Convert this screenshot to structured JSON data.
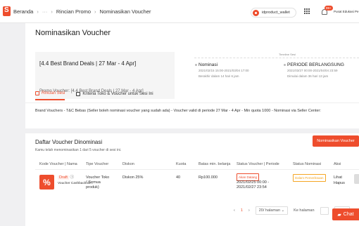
{
  "breadcrumb": {
    "home": "Beranda",
    "ellipsis": "···",
    "parent": "Rincian Promo",
    "current": "Nominasikan Voucher"
  },
  "header": {
    "wallet": "idproduct_wallet",
    "notif_badge": "99+",
    "user": "Pusat Edukasi Pe"
  },
  "page": {
    "title": "Nominasikan Voucher"
  },
  "promo": {
    "title": "[4.4 Best Brand Deals | 27 Mar - 4 Apr]",
    "voucher_line": "Promo Voucher: [4.4 Best Brand Deals | 27 Mar - 4 Apr]"
  },
  "timeline": {
    "label": "Timeline Sesi",
    "nominasi": {
      "title": "Nominasi",
      "dates": "2021/02/15 15:00-2021/03/04 17:00",
      "note": "Berakhir dalam 14 hari 6 jam"
    },
    "periode": {
      "title": "PERIODE BERLANGSUNG",
      "dates": "2021/03/27 00:00-2021/04/04 23:59",
      "note": "Dimulai dalam 36 hari 13 jam"
    }
  },
  "tabs": [
    {
      "label": "Rincian Sesi"
    },
    {
      "label": "Kriteria Toko & Voucher untuk Sesi Ini"
    }
  ],
  "description": "Brand Vouchers - T&C Bebas (Seller boleh nominasi voucher yang sudah ada) - Voucher valid di periode 27 Mar - 4 Apr - Min quota 1000 - Nominasi via Seller Center:",
  "list": {
    "title": "Daftar Voucher Dinominasi",
    "subtitle": "Kamu telah menominasikan 1 dari 5 voucher di sesi ini.",
    "add_button": "Nominasikan Voucher",
    "columns": [
      "Kode Voucher | Nama",
      "Tipe Voucher",
      "Diskon",
      "Kuota",
      "Batas min. belanja",
      "Status Voucher | Periode",
      "Status Nominasi",
      "Aksi"
    ],
    "rows": [
      {
        "code": "Draft",
        "name": "Voucher Cashback Gi...",
        "type": "Voucher Toko",
        "type_sub": "( Semua",
        "type_sub2": "produk)",
        "discount": "Diskon 25%",
        "quota": "40",
        "min_spend": "Rp100.000",
        "status": "Akan Datang",
        "period1": "2021/02/25 00:00 -",
        "period2": "2021/02/27 23:54",
        "nomination": "Dalam Pemeriksaan",
        "action_view": "Lihat",
        "action_delete": "Hapus"
      }
    ]
  },
  "pager": {
    "current": "1",
    "per_page": "20/ halaman",
    "goto_label": "Ke halaman",
    "goto_button": "Pergi"
  },
  "chat": {
    "label": "Chat"
  }
}
